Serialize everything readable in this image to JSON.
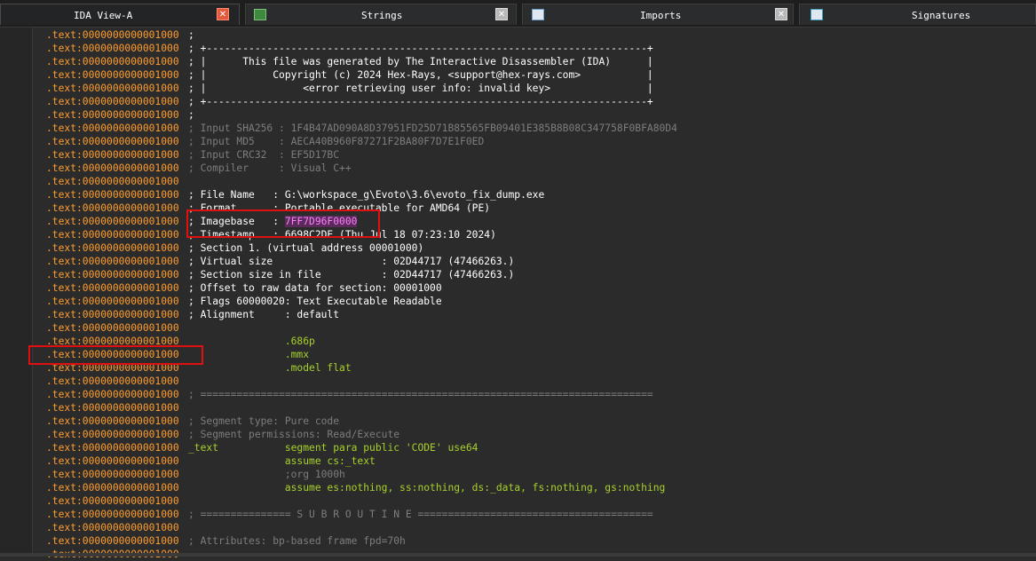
{
  "tabs": [
    {
      "label": "IDA View-A",
      "active": true,
      "icon": "close-icon"
    },
    {
      "label": "Strings",
      "active": false,
      "icon": "strings-icon"
    },
    {
      "label": "Imports",
      "active": false,
      "icon": "imports-icon"
    },
    {
      "label": "Signatures",
      "active": false,
      "icon": "signatures-icon"
    }
  ],
  "listing": {
    "address": ".text:0000000000001000",
    "lines": [
      {
        "text": ";",
        "style": "code"
      },
      {
        "text": "; +-------------------------------------------------------------------------+",
        "style": "code"
      },
      {
        "text": "; |      This file was generated by The Interactive Disassembler (IDA)      |",
        "style": "code"
      },
      {
        "text": "; |           Copyright (c) 2024 Hex-Rays, <support@hex-rays.com>           |",
        "style": "code"
      },
      {
        "text": "; |                <error retrieving user info: invalid key>                |",
        "style": "code"
      },
      {
        "text": "; +-------------------------------------------------------------------------+",
        "style": "code"
      },
      {
        "text": ";",
        "style": "code"
      },
      {
        "text": "; Input SHA256 : 1F4B47AD090A8D37951FD25D71B85565FB09401E385B8B08C347758F0BFA80D4",
        "style": "dim"
      },
      {
        "text": "; Input MD5    : AECA40B960F87271F2BA80F7D7E1F0ED",
        "style": "dim"
      },
      {
        "text": "; Input CRC32  : EF5D17BC",
        "style": "dim"
      },
      {
        "text": "; Compiler     : Visual C++",
        "style": "dim"
      },
      {
        "text": "",
        "style": "code"
      },
      {
        "text": "; File Name   : G:\\workspace_g\\Evoto\\3.6\\evoto_fix_dump.exe",
        "style": "code"
      },
      {
        "text": "; Format      : Portable executable for AMD64 (PE)",
        "style": "code"
      },
      {
        "text": "; Imagebase   : ",
        "style": "code",
        "value": "7FF7D96F0000"
      },
      {
        "text": "; Timestamp   : 6698C2DE (Thu Jul 18 07:23:10 2024)",
        "style": "code"
      },
      {
        "text": "; Section 1. (virtual address 00001000)",
        "style": "code"
      },
      {
        "text": "; Virtual size                  : 02D44717 (47466263.)",
        "style": "code"
      },
      {
        "text": "; Section size in file          : 02D44717 (47466263.)",
        "style": "code"
      },
      {
        "text": "; Offset to raw data for section: 00001000",
        "style": "code"
      },
      {
        "text": "; Flags 60000020: Text Executable Readable",
        "style": "code"
      },
      {
        "text": "; Alignment     : default",
        "style": "code"
      },
      {
        "text": "",
        "style": "code"
      },
      {
        "text": "                .686p",
        "style": "ins"
      },
      {
        "text": "                .mmx",
        "style": "ins"
      },
      {
        "text": "                .model flat",
        "style": "ins"
      },
      {
        "text": "",
        "style": "code"
      },
      {
        "text": "; ===========================================================================",
        "style": "dim"
      },
      {
        "text": "",
        "style": "code"
      },
      {
        "text": "; Segment type: Pure code",
        "style": "dim"
      },
      {
        "text": "; Segment permissions: Read/Execute",
        "style": "dim"
      },
      {
        "text": "_text           segment para public 'CODE' use64",
        "style": "ins"
      },
      {
        "text": "                assume cs:_text",
        "style": "ins"
      },
      {
        "text": "                ;org 1000h",
        "style": "dim"
      },
      {
        "text": "                assume es:nothing, ss:nothing, ds:_data, fs:nothing, gs:nothing",
        "style": "ins"
      },
      {
        "text": "",
        "style": "code"
      },
      {
        "text": "; =============== S U B R O U T I N E =======================================",
        "style": "dim"
      },
      {
        "text": "",
        "style": "code"
      },
      {
        "text": "; Attributes: bp-based frame fpd=70h",
        "style": "dim"
      },
      {
        "text": "",
        "style": "code"
      }
    ]
  },
  "colors": {
    "background": "#2b2b2b",
    "address": "#ff9d2f",
    "instruction": "#a7d12b",
    "comment_dim": "#7d7d7d",
    "highlight_box": "#e01010",
    "imagebase_value": "#ff7fff"
  }
}
